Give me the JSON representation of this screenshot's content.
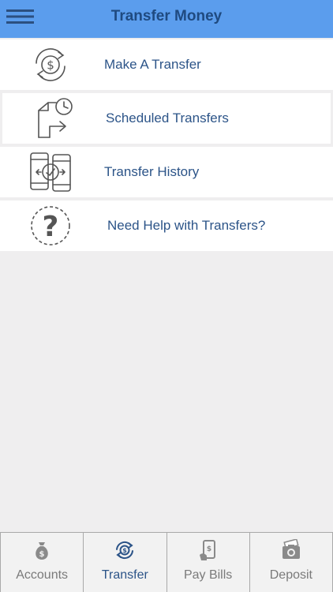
{
  "header": {
    "title": "Transfer Money",
    "menu_icon": "hamburger-menu-icon"
  },
  "menu": {
    "items": [
      {
        "label": "Make A Transfer",
        "icon": "dollar-exchange-icon"
      },
      {
        "label": "Scheduled Transfers",
        "icon": "clock-transfer-icon"
      },
      {
        "label": "Transfer History",
        "icon": "phone-to-phone-transfer-icon"
      },
      {
        "label": "Need Help with Transfers?",
        "icon": "question-mark-icon"
      }
    ]
  },
  "tabbar": {
    "tabs": [
      {
        "label": "Accounts",
        "icon": "money-bag-icon",
        "active": false
      },
      {
        "label": "Transfer",
        "icon": "dollar-cycle-icon",
        "active": true
      },
      {
        "label": "Pay Bills",
        "icon": "mobile-bill-icon",
        "active": false
      },
      {
        "label": "Deposit",
        "icon": "camera-check-icon",
        "active": false
      }
    ]
  },
  "colors": {
    "header_bg": "#5b9ded",
    "title_text": "#1f4a80",
    "link_text": "#2c5488",
    "background": "#efeeef",
    "tab_inactive": "#7a7a7a",
    "tab_active": "#2c5488"
  }
}
